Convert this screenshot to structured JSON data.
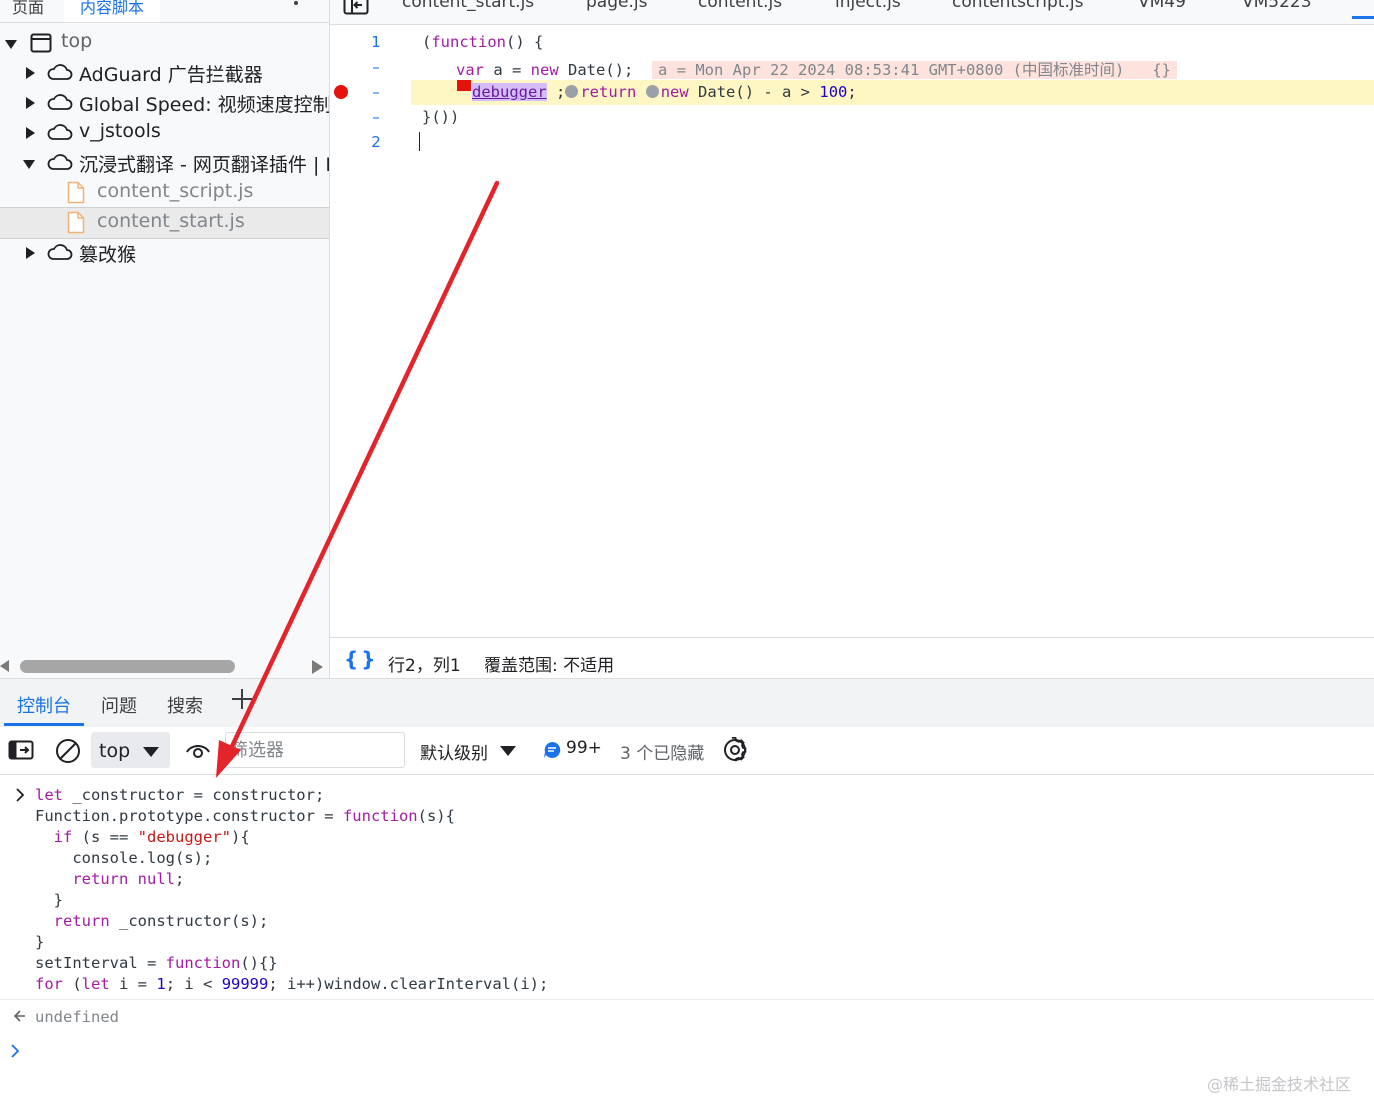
{
  "left_panel": {
    "tabs": {
      "page": "页面",
      "content_scripts": "内容脚本"
    },
    "tree": [
      {
        "label": "top"
      },
      {
        "label": "AdGuard 广告拦截器"
      },
      {
        "label": "Global Speed: 视频速度控制"
      },
      {
        "label": "v_jstools"
      },
      {
        "label": "沉浸式翻译 - 网页翻译插件 | PDF"
      },
      {
        "label": "content_script.js"
      },
      {
        "label": "content_start.js"
      },
      {
        "label": "篡改猴"
      }
    ]
  },
  "editor": {
    "tabs": [
      "content_start.js",
      "page.js",
      "content.js",
      "inject.js",
      "contentscript.js",
      "VM49",
      "VM5223"
    ],
    "line_numbers": [
      "1",
      "–",
      "–",
      "–",
      "2"
    ],
    "inline_value": "a = Mon Apr 22 2024 08:53:41 GMT+0800 (中国标准时间)   {}",
    "status": {
      "position": "行2，列1",
      "coverage": "覆盖范围: 不适用"
    }
  },
  "drawer": {
    "tabs": {
      "console": "控制台",
      "issues": "问题",
      "search": "搜索"
    }
  },
  "console_toolbar": {
    "context": "top",
    "filter_placeholder": "筛选器",
    "levels": "默认级别",
    "messages_count": "99+",
    "hidden": "3 个已隐藏"
  },
  "console": {
    "result": "undefined"
  },
  "watermark": "@稀土掘金技术社区",
  "colors": {
    "accent": "#1a73e8",
    "breakpoint": "#e3120b",
    "paused_line": "#fef7c3",
    "arrow": "#e3242b"
  }
}
